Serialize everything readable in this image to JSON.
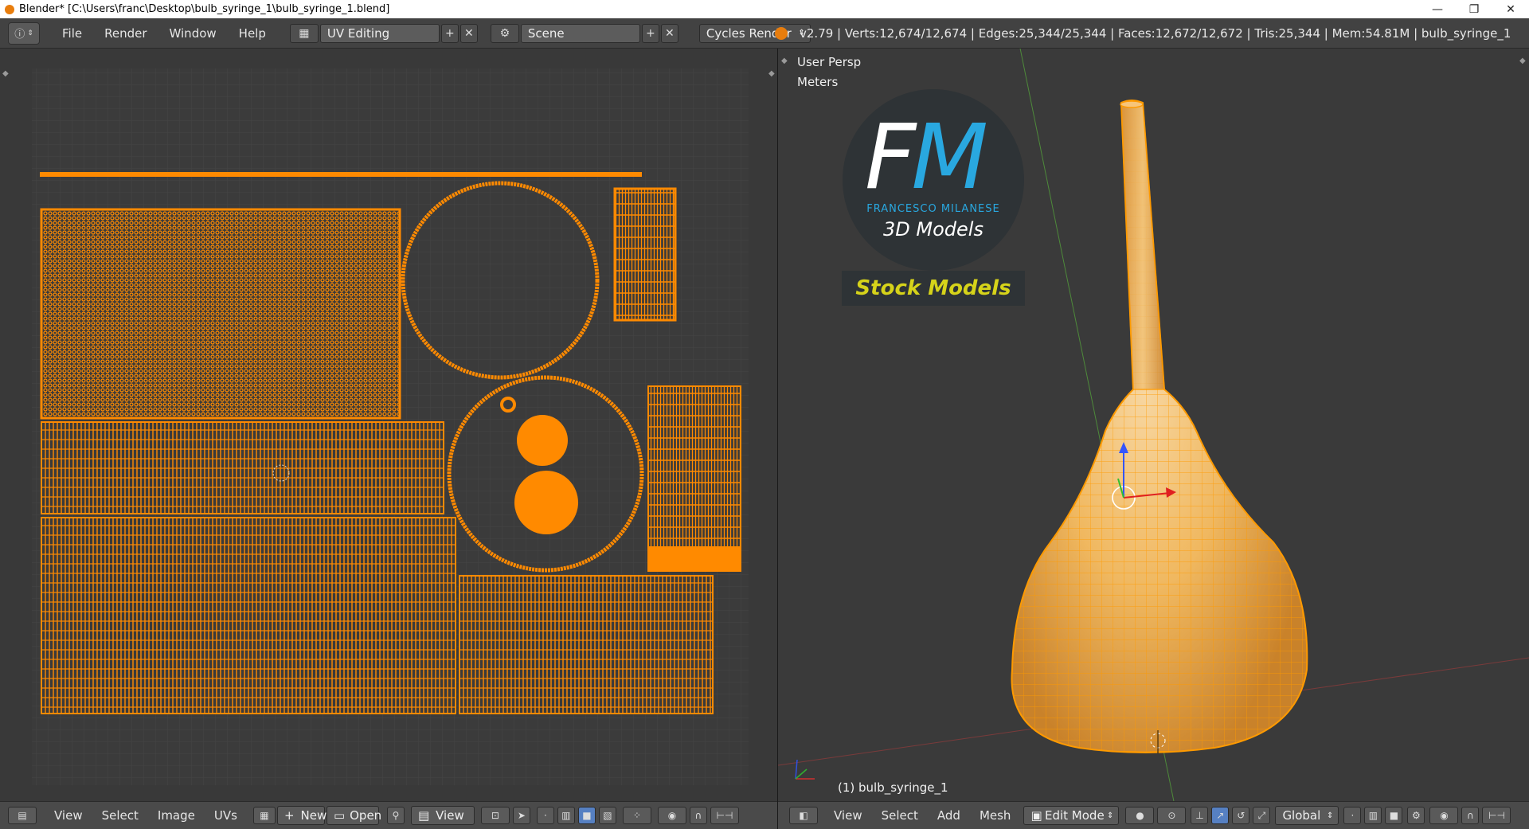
{
  "window": {
    "title": "Blender* [C:\\Users\\franc\\Desktop\\bulb_syringe_1\\bulb_syringe_1.blend]",
    "controls": {
      "minimize": "—",
      "restore": "❐",
      "close": "✕"
    }
  },
  "info_header": {
    "menus": [
      "File",
      "Render",
      "Window",
      "Help"
    ],
    "screen_layout": "UV Editing",
    "scene": "Scene",
    "render_engine": "Cycles Render",
    "stats": "v2.79 | Verts:12,674/12,674 | Edges:25,344/25,344 | Faces:12,672/12,672 | Tris:25,344 | Mem:54.81M | bulb_syringe_1"
  },
  "uv_editor": {
    "menus": [
      "View",
      "Select",
      "Image",
      "UVs"
    ],
    "new_label": "New",
    "open_label": "Open",
    "view_label": "View"
  },
  "viewport": {
    "view_name": "User Persp",
    "units": "Meters",
    "object_label": "(1) bulb_syringe_1",
    "menus": [
      "View",
      "Select",
      "Add",
      "Mesh"
    ],
    "mode": "Edit Mode",
    "orientation": "Global",
    "watermark": {
      "logo_text": "FM",
      "author": "FRANCESCO MILANESE",
      "line2": "3D Models",
      "banner": "Stock Models"
    }
  },
  "colors": {
    "uv_orange": "#ff8a00",
    "mesh_orange": "#f5a623",
    "logo_blue": "#29a8e0",
    "banner_yellow": "#d6d31a",
    "active_button": "#5680c2"
  }
}
